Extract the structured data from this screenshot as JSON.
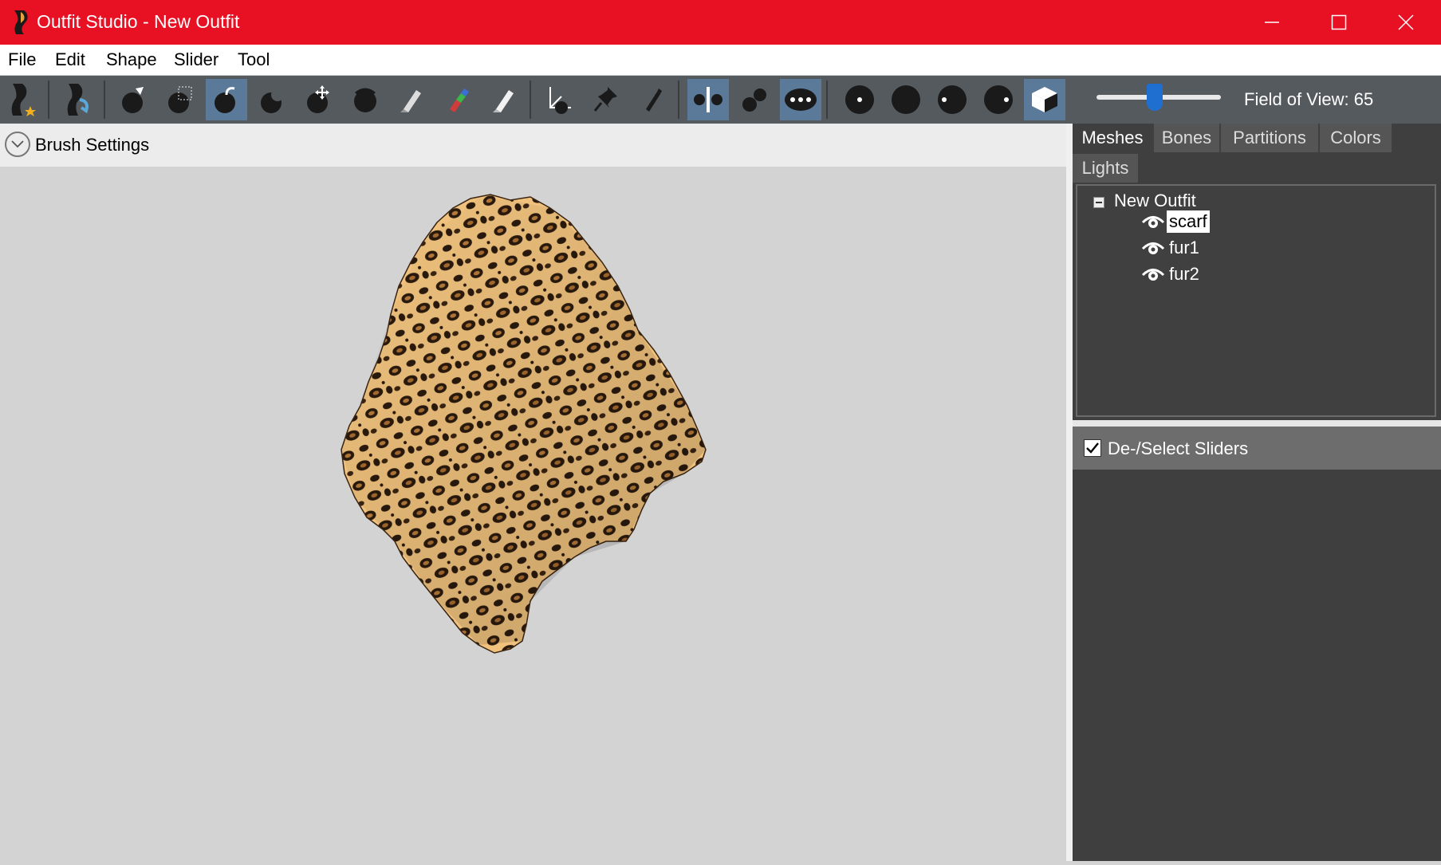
{
  "window": {
    "title": "Outfit Studio - New Outfit",
    "title_bar_color": "#e81123",
    "controls": [
      "minimize-icon",
      "maximize-icon",
      "close-icon"
    ]
  },
  "menu": [
    "File",
    "Edit",
    "Shape",
    "Slider",
    "Tool"
  ],
  "toolbar": {
    "buttons": [
      {
        "icon": "new-project-icon",
        "active": false
      },
      {
        "icon": "load-project-icon",
        "active": false
      },
      {
        "icon": "select-brush-icon",
        "active": false
      },
      {
        "icon": "mask-brush-icon",
        "active": false
      },
      {
        "icon": "inflate-brush-icon",
        "active": true
      },
      {
        "icon": "deflate-brush-icon",
        "active": false
      },
      {
        "icon": "move-brush-icon",
        "active": false
      },
      {
        "icon": "smooth-brush-icon",
        "active": false
      },
      {
        "icon": "weight-brush-icon",
        "active": false
      },
      {
        "icon": "color-brush-icon",
        "active": false
      },
      {
        "icon": "alpha-brush-icon",
        "active": false
      },
      {
        "icon": "transform-icon",
        "active": false
      },
      {
        "icon": "pivot-icon",
        "active": false
      },
      {
        "icon": "vertex-edit-icon",
        "active": false
      },
      {
        "icon": "x-mirror-icon",
        "active": true
      },
      {
        "icon": "connected-only-icon",
        "active": false
      },
      {
        "icon": "global-brush-icon",
        "active": true
      },
      {
        "icon": "wireframe-icon",
        "active": false
      },
      {
        "icon": "lighting-icon",
        "active": false
      },
      {
        "icon": "texture-icon",
        "active": false
      },
      {
        "icon": "vertex-colors-icon",
        "active": false
      },
      {
        "icon": "cube-view-icon",
        "active": true
      }
    ],
    "field_of_view_label": "Field of View: 65",
    "field_of_view_value": 65
  },
  "brush_settings": {
    "label": "Brush Settings"
  },
  "viewport": {
    "model": "leopard-print-scarf-mesh",
    "background": "#d3d3d3"
  },
  "right_panel": {
    "tabs": [
      {
        "label": "Meshes",
        "active": true
      },
      {
        "label": "Bones",
        "active": false
      },
      {
        "label": "Partitions",
        "active": false
      },
      {
        "label": "Colors",
        "active": false
      },
      {
        "label": "Lights",
        "active": false
      }
    ],
    "tree": {
      "root": "New Outfit",
      "items": [
        {
          "label": "scarf",
          "selected": true,
          "visible": true
        },
        {
          "label": "fur1",
          "selected": false,
          "visible": true
        },
        {
          "label": "fur2",
          "selected": false,
          "visible": true
        }
      ]
    },
    "sliders": {
      "select_all_label": "De-/Select Sliders",
      "checked": true
    }
  }
}
